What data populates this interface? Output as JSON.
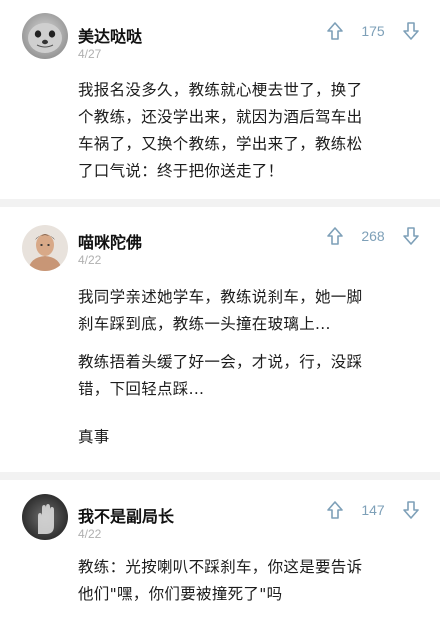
{
  "comments": [
    {
      "username": "美达哒哒",
      "date": "4/27",
      "votes": "175",
      "avatar": "seal-photo",
      "paragraphs": [
        "我报名没多久，教练就心梗去世了，换了\n个教练，还没学出来，就因为酒后驾车出\n车祸了，又换个教练，学出来了，教练松\n了口气说：终于把你送走了！"
      ]
    },
    {
      "username": "喵咪陀佛",
      "date": "4/22",
      "votes": "268",
      "avatar": "person-photo",
      "paragraphs": [
        "我同学亲述她学车，教练说刹车，她一脚\n刹车踩到底，教练一头撞在玻璃上...",
        "教练捂着头缓了好一会，才说，行，没踩\n错，下回轻点踩...",
        "真事"
      ]
    },
    {
      "username": "我不是副局长",
      "date": "4/22",
      "votes": "147",
      "avatar": "hand-photo",
      "paragraphs": [
        "教练：光按喇叭不踩刹车，你这是要告诉\n他们\"嘿，你们要被撞死了\"吗"
      ]
    }
  ],
  "icons": {
    "upvote": "arrow-up-icon",
    "downvote": "arrow-down-icon"
  },
  "colors": {
    "vote_accent": "#7ea0b8",
    "background": "#f2f2f2",
    "card": "#ffffff"
  }
}
